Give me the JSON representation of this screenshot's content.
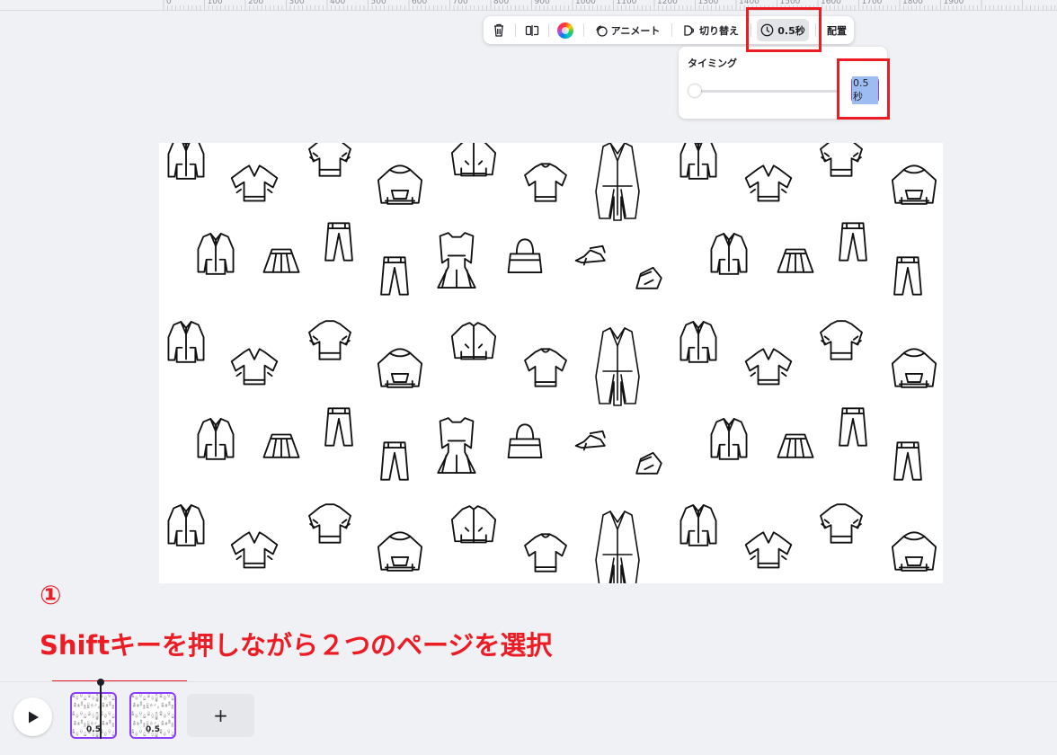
{
  "ruler": {
    "ticks": [
      "0",
      "100",
      "200",
      "300",
      "400",
      "500",
      "600",
      "700",
      "800",
      "900",
      "1000",
      "1100",
      "1200",
      "1300",
      "1400",
      "1500",
      "1600",
      "1700",
      "1800",
      "1900"
    ]
  },
  "toolbar": {
    "delete_icon": "trash-icon",
    "flip_icon": "flip-icon",
    "color_icon": "color-wheel-icon",
    "animate_label": "アニメート",
    "transition_label": "切り替え",
    "timing_label": "0.5秒",
    "position_label": "配置"
  },
  "timing_popover": {
    "title": "タイミング",
    "value": "0.5秒",
    "slider_level": 0.0
  },
  "annotation": {
    "step_number": "①",
    "instruction": "Shiftキーを押しながら２つのページを選択"
  },
  "timeline": {
    "play_icon": "play-icon",
    "pages": [
      {
        "duration_label": "0.5"
      },
      {
        "duration_label": "0.5"
      }
    ],
    "add_page_label": "+"
  },
  "colors": {
    "accent": "#8b3dff",
    "highlight_red": "#ec1c24",
    "background": "#f0f1f5"
  }
}
